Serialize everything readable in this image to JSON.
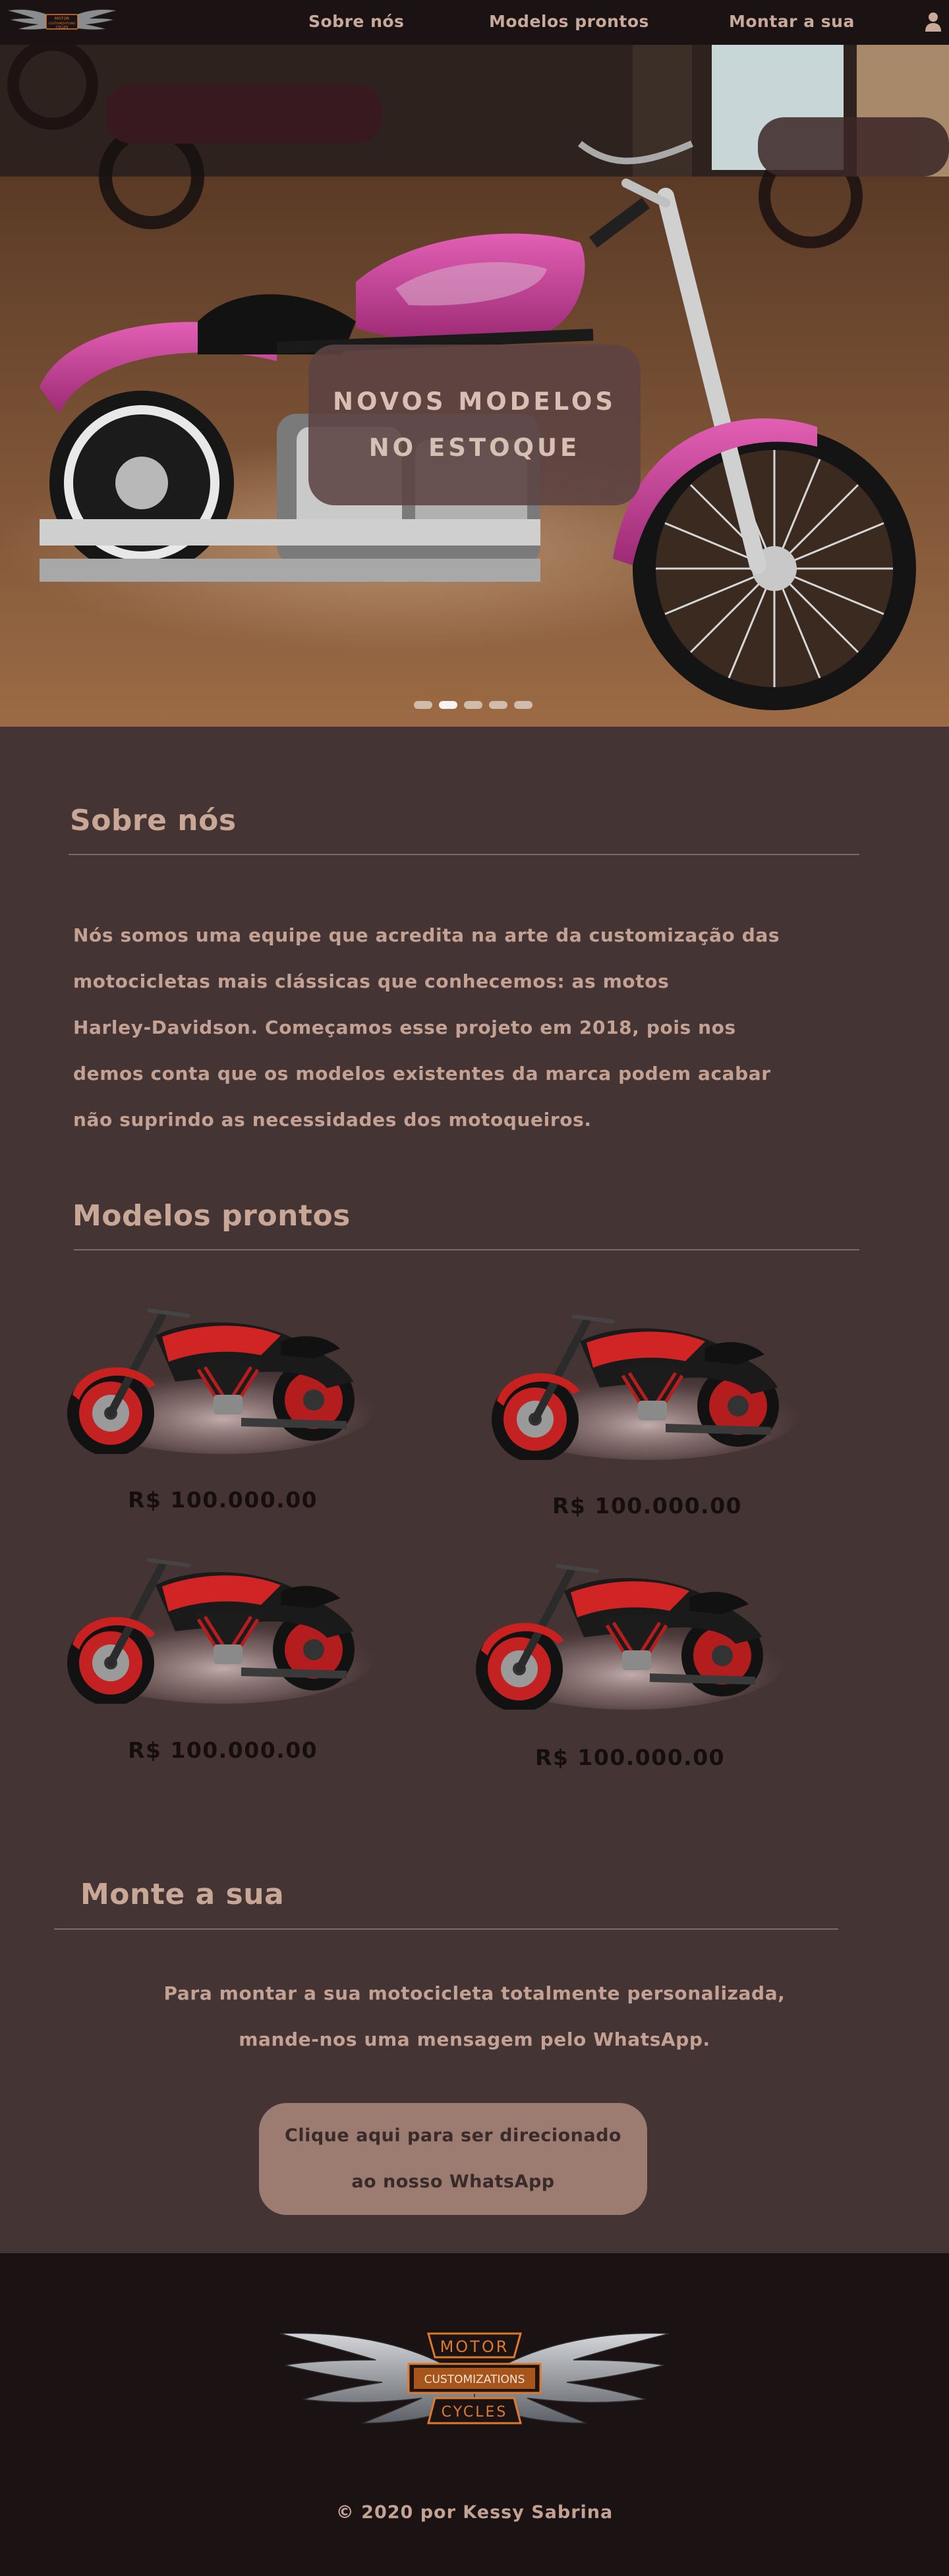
{
  "nav": {
    "logo_lines": [
      "MOTOR",
      "CUSTOMIZATIONS",
      "CYCLES"
    ],
    "links": [
      "Sobre nós",
      "Modelos prontos",
      "Montar a sua"
    ],
    "user_icon": "user-icon"
  },
  "hero": {
    "caption_lines": [
      "NOVOS  MODELOS",
      "NO  ESTOQUE"
    ],
    "slide_count": 5,
    "active_slide": 2,
    "accent_color": "#c23c8f"
  },
  "about": {
    "title": "Sobre nós",
    "lines": [
      "Nós somos uma equipe que acredita na arte da customização das",
      "motocicletas mais clássicas que conhecemos: as motos",
      "Harley-Davidson. Começamos esse projeto em 2018, pois nos",
      "demos conta que os modelos existentes da marca podem acabar",
      "não suprindo as necessidades dos motoqueiros."
    ]
  },
  "models": {
    "title": "Modelos prontos",
    "items": [
      {
        "price": "R$ 100.000.00"
      },
      {
        "price": "R$ 100.000.00"
      },
      {
        "price": "R$ 100.000.00"
      },
      {
        "price": "R$ 100.000.00"
      }
    ]
  },
  "monte": {
    "title": "Monte a sua",
    "lines": [
      "Para montar a sua motocicleta totalmente personalizada,",
      "mande-nos uma mensagem pelo WhatsApp."
    ],
    "button_lines": [
      "Clique aqui para ser direcionado",
      "ao nosso WhatsApp"
    ]
  },
  "footer": {
    "logo_lines": [
      "MOTOR",
      "CUSTOMIZATIONS",
      "CYCLES"
    ],
    "copyright": "© 2020 por Kessy Sabrina"
  },
  "colors": {
    "background": "#453434",
    "navbar": "#1a1213",
    "text": "#c9a796",
    "button": "#9c7b70",
    "logo_orange": "#e07a2a"
  }
}
